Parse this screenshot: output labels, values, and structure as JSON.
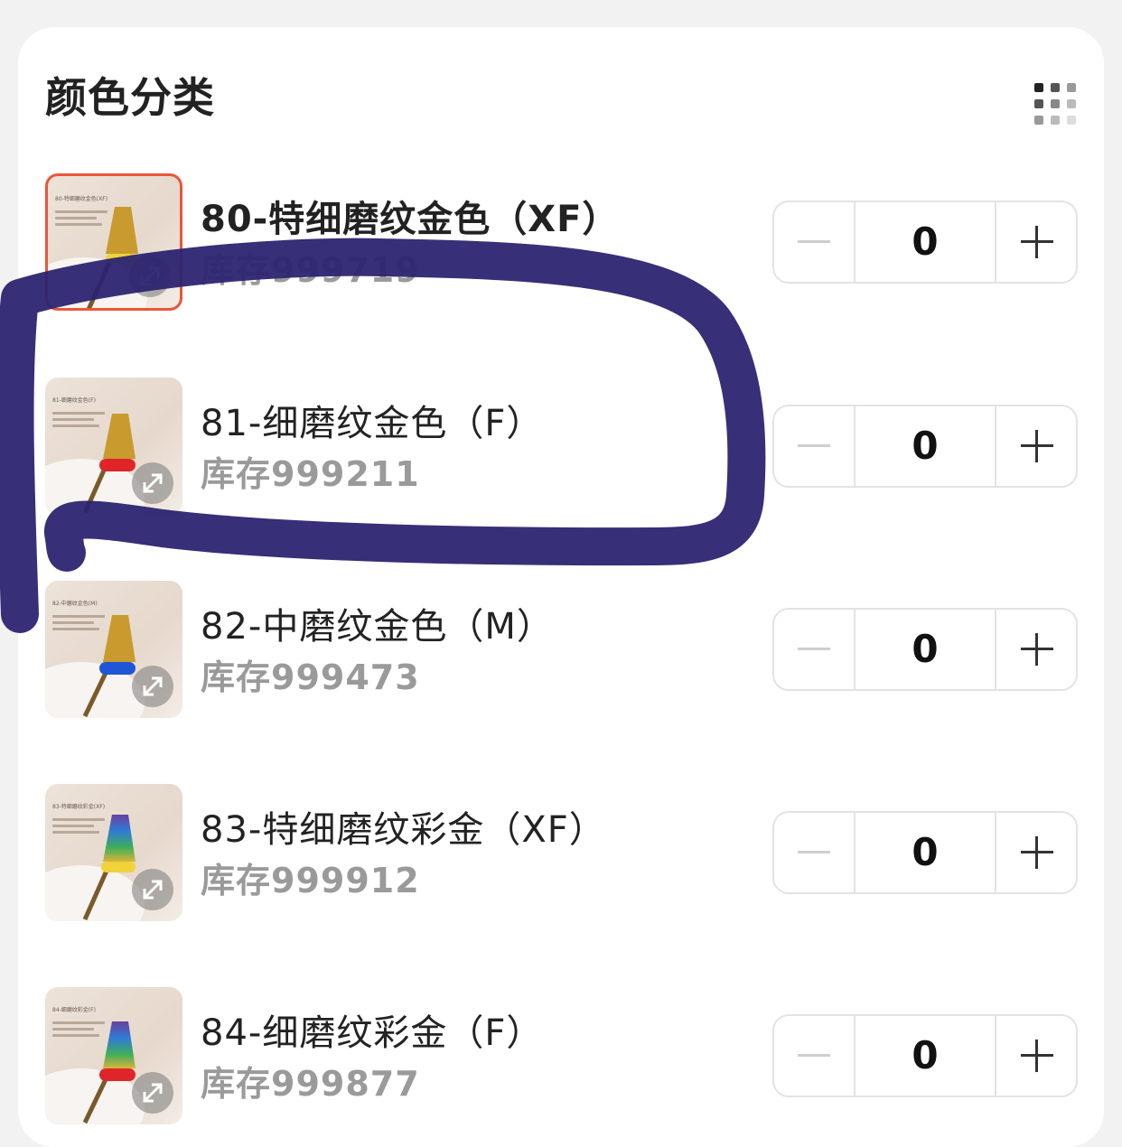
{
  "section": {
    "title": "颜色分类"
  },
  "items": [
    {
      "name": "80-特细磨纹金色（XF）",
      "stock": "库存999719",
      "quantity": "0",
      "thumb_caption": "80-特细磨纹金色(XF)",
      "band_color": "#f0d23a",
      "selected": true
    },
    {
      "name": "81-细磨纹金色（F）",
      "stock": "库存999211",
      "quantity": "0",
      "thumb_caption": "81-细磨纹金色(F)",
      "band_color": "#e0252a",
      "selected": false
    },
    {
      "name": "82-中磨纹金色（M）",
      "stock": "库存999473",
      "quantity": "0",
      "thumb_caption": "82-中磨纹金色(M)",
      "band_color": "#1f56d6",
      "selected": false
    },
    {
      "name": "83-特细磨纹彩金（XF）",
      "stock": "库存999912",
      "quantity": "0",
      "thumb_caption": "83-特细磨纹彩金(XF)",
      "band_color": "#f0d23a",
      "selected": false
    },
    {
      "name": "84-细磨纹彩金（F）",
      "stock": "库存999877",
      "quantity": "0",
      "thumb_caption": "84-细磨纹彩金(F)",
      "band_color": "#e0252a",
      "selected": false
    }
  ],
  "colors": {
    "annotation_stroke": "#2c2470",
    "selected_border": "#e8573a"
  }
}
